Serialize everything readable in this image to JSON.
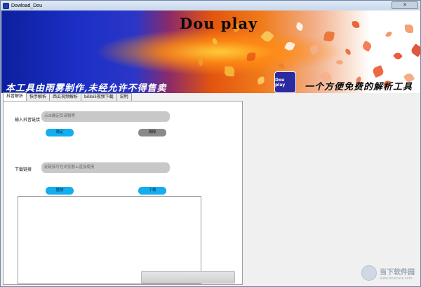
{
  "window": {
    "title": "Dowload_Dou"
  },
  "banner": {
    "title": "Dou play",
    "left_slogan": "本工具由雨雾制作,未经允许不得售卖",
    "logo_text": "Dou play",
    "right_slogan": "一个方便免费的解析工具"
  },
  "tabs": [
    {
      "label": "抖音解析",
      "active": true
    },
    {
      "label": "快手解析",
      "active": false
    },
    {
      "label": "西瓜视频解析",
      "active": false
    },
    {
      "label": "bilibili视频下载",
      "active": false
    },
    {
      "label": "说明",
      "active": false
    }
  ],
  "form": {
    "input_label": "输入抖音链接",
    "input_placeholder": "点击确定后请稍等",
    "confirm_label": "确定",
    "clear_label": "清除",
    "download_label": "下载链接",
    "download_placeholder": "此链接可在浏览器上直接使用",
    "play_label": "播放",
    "download_button": "下载"
  },
  "watermark": {
    "main": "当下软件园",
    "sub": "www.downxia.com"
  },
  "colors": {
    "accent": "#12aeee",
    "banner_blue": "#1b2fc5",
    "banner_orange": "#f07a1a"
  }
}
